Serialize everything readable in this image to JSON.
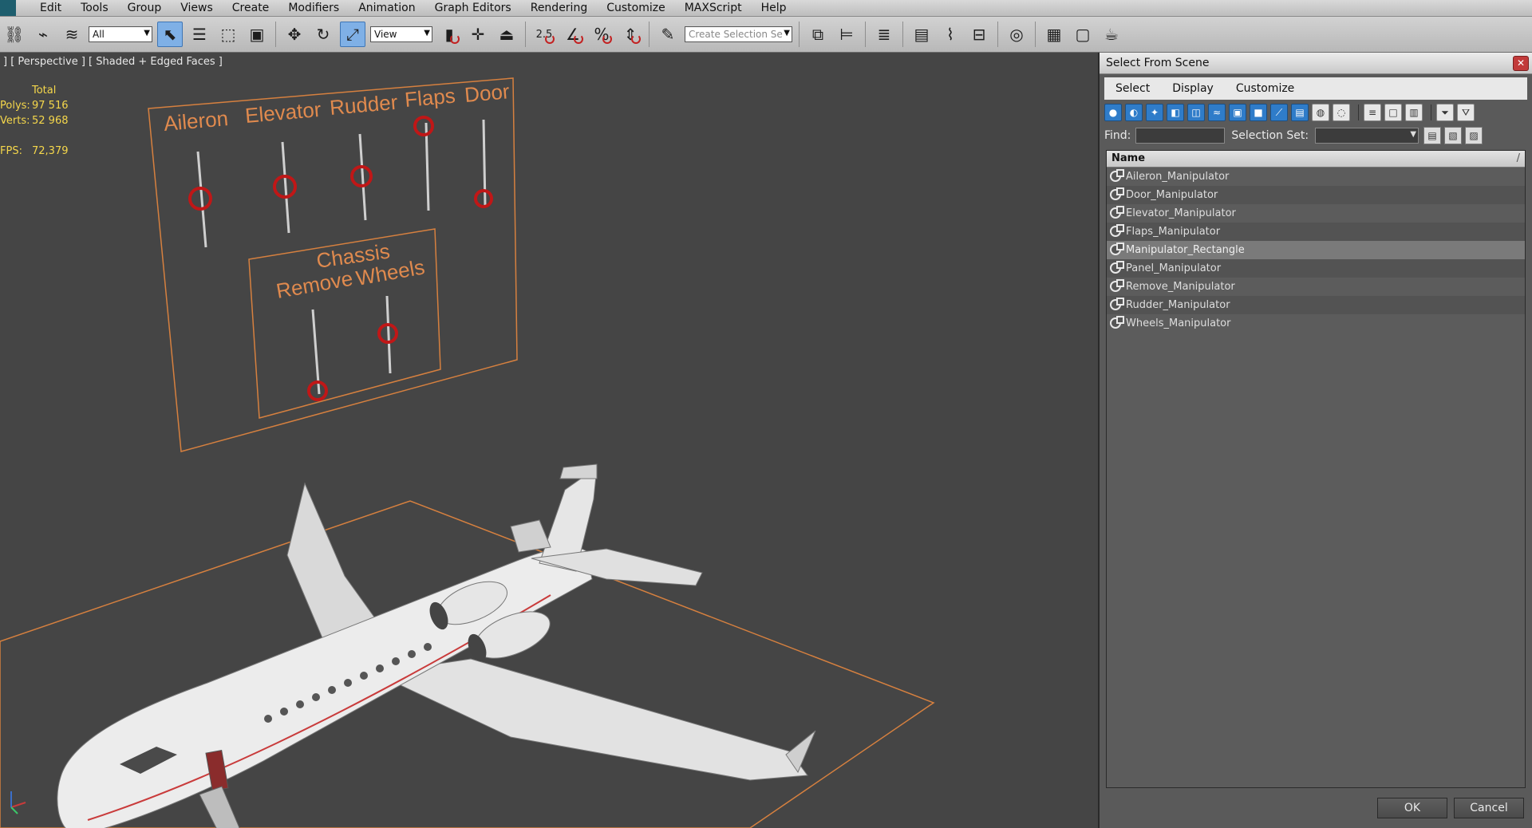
{
  "menubar": {
    "items": [
      "Edit",
      "Tools",
      "Group",
      "Views",
      "Create",
      "Modifiers",
      "Animation",
      "Graph Editors",
      "Rendering",
      "Customize",
      "MAXScript",
      "Help"
    ]
  },
  "toolbar": {
    "selection_filter": "All",
    "view_value": "View",
    "snap_value": "2.5",
    "percent_label": "%",
    "selection_set_placeholder": "Create Selection Se"
  },
  "viewport": {
    "label": "] [ Perspective ] [ Shaded + Edged Faces ]",
    "stats": {
      "total_label": "Total",
      "polys_label": "Polys:",
      "polys_value": "97 516",
      "verts_label": "Verts:",
      "verts_value": "52 968",
      "fps_label": "FPS:",
      "fps_value": "72,379"
    },
    "panel_labels": {
      "aileron": "Aileron",
      "elevator": "Elevator",
      "rudder": "Rudder",
      "flaps": "Flaps",
      "door": "Door",
      "chassis": "Chassis",
      "remove": "Remove",
      "wheels": "Wheels"
    },
    "accent_color": "#e08a4e",
    "slider_handle_color": "#c01717"
  },
  "dialog": {
    "title": "Select From Scene",
    "close_glyph": "✕",
    "menu": [
      "Select",
      "Display",
      "Customize"
    ],
    "find_label": "Find:",
    "selection_set_label": "Selection Set:",
    "list_header": "Name",
    "list_header_sort": "/",
    "rows": [
      "Aileron_Manipulator",
      "Door_Manipulator",
      "Elevator_Manipulator",
      "Flaps_Manipulator",
      "Manipulator_Rectangle",
      "Panel_Manipulator",
      "Remove_Manipulator",
      "Rudder_Manipulator",
      "Wheels_Manipulator"
    ],
    "selected_row": "Manipulator_Rectangle",
    "ok_label": "OK",
    "cancel_label": "Cancel"
  }
}
